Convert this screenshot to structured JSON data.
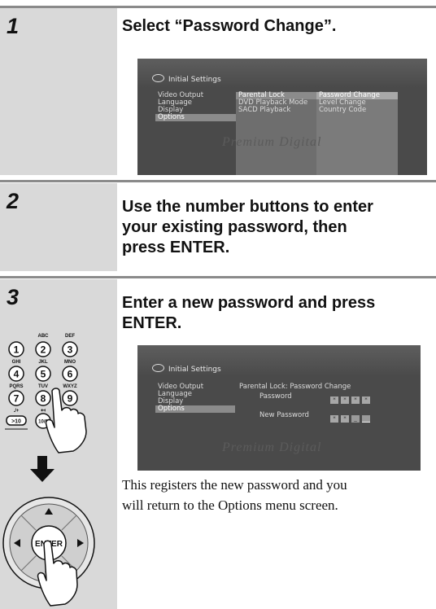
{
  "steps": [
    {
      "number": "1",
      "title": "Select “Password Change”."
    },
    {
      "number": "2",
      "title_lines": [
        "Use the number buttons to enter",
        "your existing password, then",
        "press ENTER."
      ]
    },
    {
      "number": "3",
      "title_lines": [
        "Enter a new password and press",
        "ENTER."
      ],
      "body_lines": [
        "This registers the new password and you",
        "will return to the Options menu screen."
      ]
    }
  ],
  "screen1": {
    "header": "Initial Settings",
    "menu": [
      "Video Output",
      "Language",
      "Display",
      "Options"
    ],
    "selected_menu": "Options",
    "submenu": [
      "Parental Lock",
      "DVD Playback Mode",
      "SACD Playback"
    ],
    "selected_submenu": "Parental Lock",
    "options": [
      "Password Change",
      "Level Change",
      "Country Code"
    ],
    "selected_option": "Password Change",
    "watermark": "Premium Digital"
  },
  "screen2": {
    "header": "Initial Settings",
    "menu": [
      "Video Output",
      "Language",
      "Display",
      "Options"
    ],
    "selected_menu": "Options",
    "title": "Parental Lock: Password Change",
    "password_label": "Password",
    "password_boxes": [
      "*",
      "*",
      "*",
      "*"
    ],
    "new_password_label": "New Password",
    "new_password_boxes": [
      "*",
      "*",
      "_",
      ""
    ],
    "watermark": "Premium Digital"
  },
  "remote": {
    "keys": [
      {
        "num": "1",
        "letters": ""
      },
      {
        "num": "2",
        "letters": "ABC"
      },
      {
        "num": "3",
        "letters": "DEF"
      },
      {
        "num": "4",
        "letters": "GHI"
      },
      {
        "num": "5",
        "letters": "JKL"
      },
      {
        "num": "6",
        "letters": "MNO"
      },
      {
        "num": "7",
        "letters": "PQRS"
      },
      {
        "num": "8",
        "letters": "TUV"
      },
      {
        "num": "9",
        "letters": "WXYZ"
      }
    ],
    "key_plus10": ">10",
    "key_plus10_sub": "./+",
    "key_0": "10/0",
    "key_0_sub": "↤",
    "enter_label": "ENTER"
  }
}
